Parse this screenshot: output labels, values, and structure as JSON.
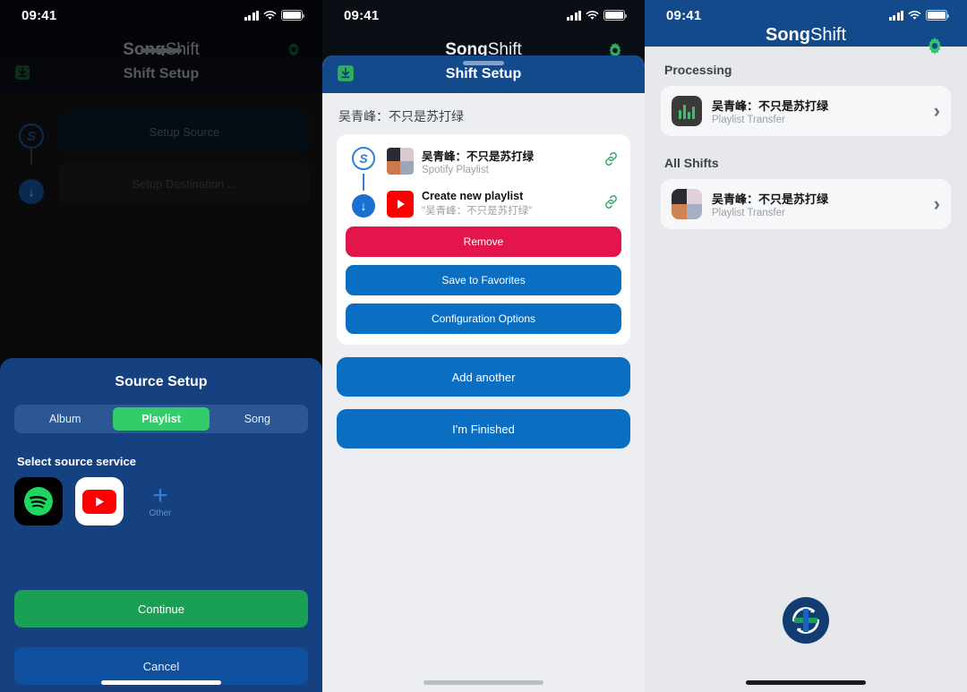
{
  "status_bar": {
    "time": "09:41",
    "icons": [
      "cellular-signal-icon",
      "wifi-icon",
      "battery-icon"
    ]
  },
  "colors": {
    "nav_blue": "#124a8c",
    "sheet_blue": "#154180",
    "accent_green": "#33cc6a",
    "button_blue": "#0a6fc2",
    "danger_red": "#e4154b",
    "continue_green": "#1aa055"
  },
  "panel1": {
    "background_app_title_bold": "Song",
    "background_app_title_thin": "Shift",
    "sheet_header_title": "Shift Setup",
    "sheet_header_icon": "import-export-icon",
    "gear_icon": "gear-icon",
    "rail": {
      "source_icon": "spotify-source-badge",
      "source_letter": "S",
      "dest_icon": "arrow-down-circle-icon"
    },
    "setup_source_label": "Setup Source",
    "setup_destination_label": "Setup Destination ...",
    "source_setup": {
      "title": "Source Setup",
      "segments": [
        {
          "label": "Album",
          "selected": false
        },
        {
          "label": "Playlist",
          "selected": true
        },
        {
          "label": "Song",
          "selected": false
        }
      ],
      "select_label": "Select source service",
      "services": [
        {
          "name": "Spotify",
          "icon": "spotify-icon"
        },
        {
          "name": "YouTube Music",
          "icon": "youtube-music-icon"
        },
        {
          "name": "Other",
          "icon": "plus-icon",
          "label": "Other"
        }
      ],
      "continue_label": "Continue",
      "cancel_label": "Cancel"
    }
  },
  "panel2": {
    "background_app_title_bold": "Song",
    "background_app_title_thin": "Shift",
    "gear_icon": "gear-icon",
    "sheet_header_title": "Shift Setup",
    "sheet_header_icon": "import-export-icon",
    "group_title": "吴青峰：不只是苏打绿",
    "rail": {
      "source_letter": "S",
      "dest_icon": "arrow-down-circle-icon"
    },
    "rows": [
      {
        "title": "吴青峰：不只是苏打绿",
        "subtitle": "Spotify Playlist",
        "thumb": "album-mosaic-thumbnail",
        "action_icon": "edit-link-icon"
      },
      {
        "title": "Create new playlist",
        "subtitle": "\"吴青峰：不只是苏打绿\"",
        "thumb": "youtube-music-icon",
        "action_icon": "edit-link-icon"
      }
    ],
    "card_buttons": [
      {
        "label": "Remove",
        "style": "remove"
      },
      {
        "label": "Save to Favorites",
        "style": "blue"
      },
      {
        "label": "Configuration Options",
        "style": "blue"
      }
    ],
    "outer_buttons": [
      {
        "label": "Add another"
      },
      {
        "label": "I'm Finished"
      }
    ]
  },
  "panel3": {
    "nav_title_bold": "Song",
    "nav_title_thin": "Shift",
    "gear_icon": "gear-icon",
    "sections": [
      {
        "title": "Processing",
        "items": [
          {
            "title": "吴青峰：不只是苏打绿",
            "subtitle": "Playlist Transfer",
            "thumb": "equalizer-icon",
            "chevron": "chevron-right-icon"
          }
        ]
      },
      {
        "title": "All Shifts",
        "items": [
          {
            "title": "吴青峰：不只是苏打绿",
            "subtitle": "Playlist Transfer",
            "thumb": "album-mosaic-thumbnail",
            "chevron": "chevron-right-icon"
          }
        ]
      }
    ],
    "fab_icon": "add-shift-icon"
  }
}
